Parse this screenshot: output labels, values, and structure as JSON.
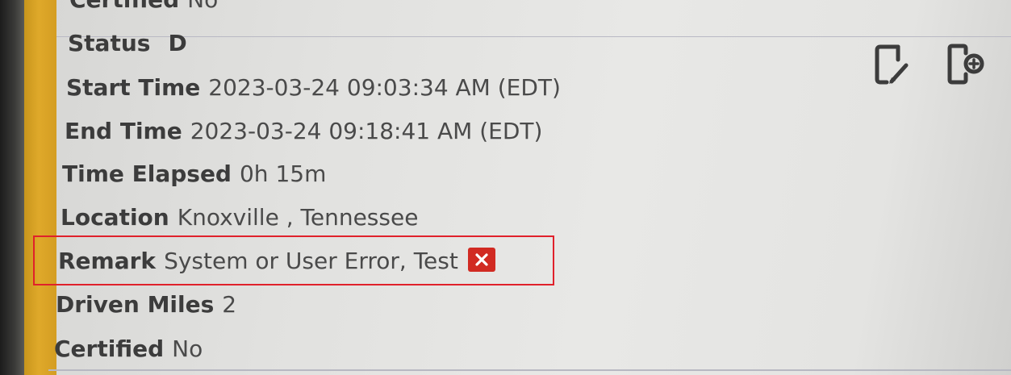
{
  "fields": [
    {
      "label": "Certified",
      "value": "No"
    },
    {
      "label": "Status",
      "value": "D"
    },
    {
      "label": "Start Time",
      "value": "2023-03-24 09:03:34 AM (EDT)"
    },
    {
      "label": "End Time",
      "value": "2023-03-24 09:18:41 AM (EDT)"
    },
    {
      "label": "Time Elapsed",
      "value": "0h 15m"
    },
    {
      "label": "Location",
      "value": "Knoxville , Tennessee"
    },
    {
      "label": "Remark",
      "value": "System or User Error, Test"
    },
    {
      "label": "Driven Miles",
      "value": "2"
    },
    {
      "label": "Certified",
      "value": "No"
    }
  ],
  "icons": {
    "edit": "edit-document-icon",
    "add": "add-document-icon",
    "remove_remark": "close-icon"
  },
  "colors": {
    "accent": "#dba726",
    "highlight": "#e0212b",
    "remove_button": "#d12a22",
    "icon": "#3c3c3c"
  }
}
